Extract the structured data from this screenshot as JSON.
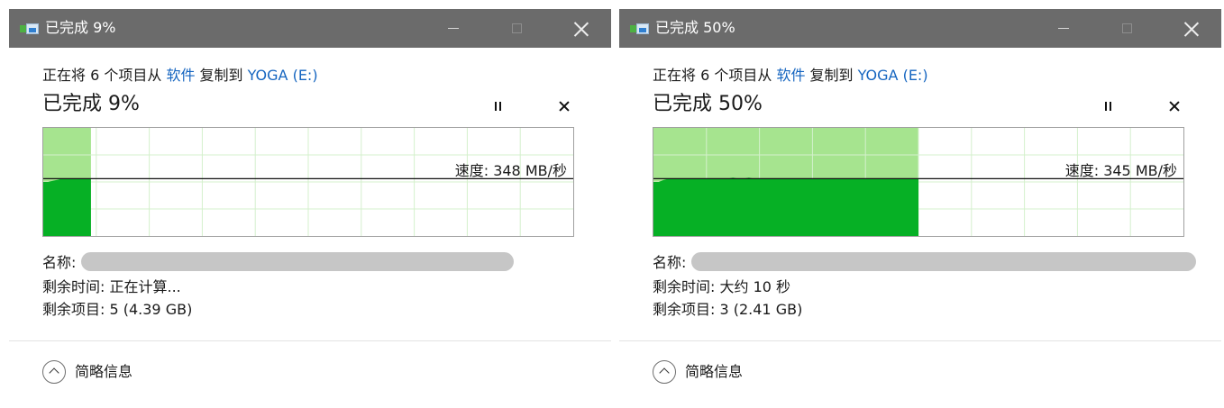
{
  "dialogs": [
    {
      "title": "已完成 9%",
      "description": {
        "prefix": "正在将 6 个项目从 ",
        "source": "软件",
        "middle": " 复制到 ",
        "destination": "YOGA (E:)"
      },
      "progress_title": "已完成 9%",
      "progress_percent": 9,
      "speed": "速度: 348 MB/秒",
      "name_label": "名称:",
      "remaining_time": "剩余时间: 正在计算...",
      "remaining_items": "剩余项目: 5 (4.39 GB)",
      "more_info_label": "简略信息",
      "speed_line_level": 0.53,
      "rates": [
        0.5,
        0.5,
        0.51,
        0.52,
        0.53,
        0.53,
        0.53,
        0.53,
        0.53,
        0.53,
        0.53
      ]
    },
    {
      "title": "已完成 50%",
      "description": {
        "prefix": "正在将 6 个项目从 ",
        "source": "软件",
        "middle": " 复制到 ",
        "destination": "YOGA (E:)"
      },
      "progress_title": "已完成 50%",
      "progress_percent": 50,
      "speed": "速度: 345 MB/秒",
      "name_label": "名称:",
      "remaining_time": "剩余时间: 大约 10 秒",
      "remaining_items": "剩余项目: 3 (2.41 GB)",
      "more_info_label": "简略信息",
      "speed_line_level": 0.53,
      "rates": [
        0.5,
        0.5,
        0.52,
        0.53,
        0.53,
        0.53,
        0.53,
        0.53,
        0.53,
        0.53,
        0.53,
        0.53,
        0.53,
        0.53,
        0.53,
        0.54,
        0.53,
        0.53,
        0.54,
        0.53,
        0.53,
        0.53,
        0.53,
        0.53,
        0.53,
        0.53,
        0.53,
        0.53,
        0.53,
        0.53,
        0.53,
        0.53,
        0.53,
        0.53,
        0.53,
        0.53,
        0.53,
        0.53,
        0.53,
        0.53,
        0.53,
        0.53,
        0.53,
        0.53,
        0.53,
        0.53,
        0.53,
        0.53,
        0.53,
        0.53,
        0.53
      ]
    }
  ],
  "colors": {
    "titlebar": "#6b6b6b",
    "progress_light": "#a6e48f",
    "progress_dark": "#06b025",
    "grid": "#d4f0cc",
    "link": "#1565c0"
  }
}
